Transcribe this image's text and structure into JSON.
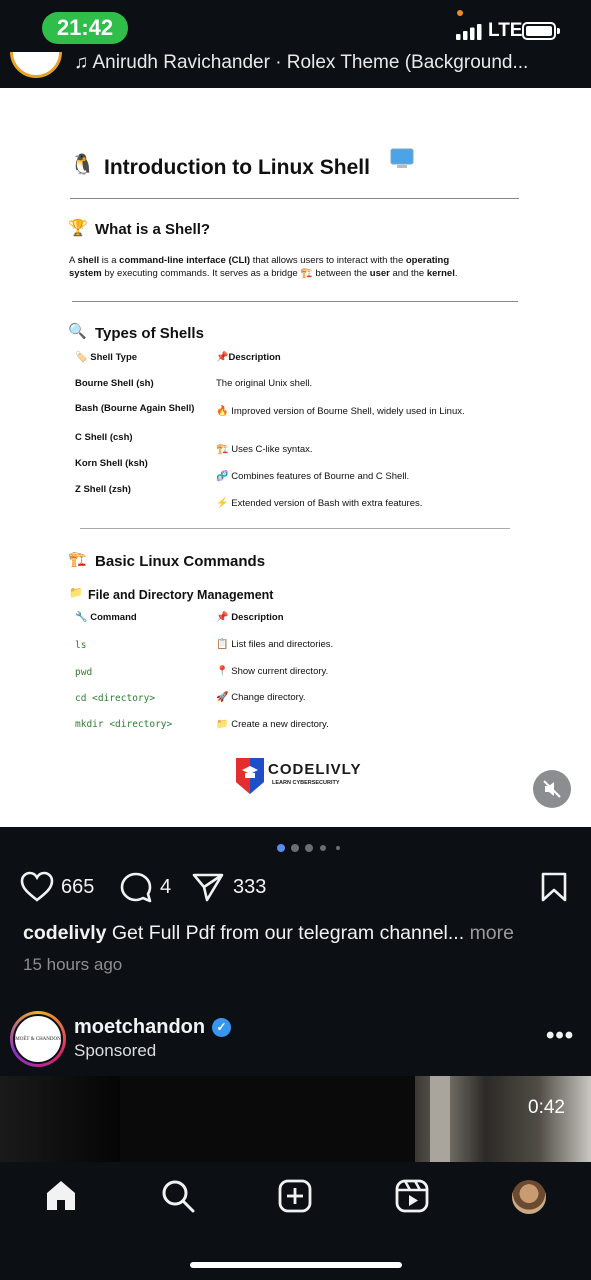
{
  "status_bar": {
    "time": "21:42",
    "network": "LTE"
  },
  "audio": {
    "text": "Anirudh Ravichander · Rolex Theme (Background..."
  },
  "post_image": {
    "title": "Introduction to Linux Shell",
    "what_heading": "What is a Shell?",
    "what_body": {
      "p1": "A ",
      "b1": "shell",
      "p2": " is a ",
      "b2": "command-line interface (CLI)",
      "p3": " that allows users to interact with the ",
      "b3": "operating",
      "b4": "system",
      "p4": " by executing commands. It serves as a bridge ",
      "p5": " between the ",
      "b5": "user",
      "p6": " and the ",
      "b6": "kernel",
      "p7": "."
    },
    "types_heading": "Types of Shells",
    "types_headers": [
      "Shell Type",
      "Description"
    ],
    "types_rows": [
      {
        "name": "Bourne Shell (sh)",
        "desc": "The original Unix shell."
      },
      {
        "name": "Bash (Bourne Again Shell)",
        "desc": "Improved version of Bourne Shell, widely used in Linux."
      },
      {
        "name": "C Shell (csh)",
        "desc": "Uses C-like syntax."
      },
      {
        "name": "Korn Shell (ksh)",
        "desc": "Combines features of Bourne and C Shell."
      },
      {
        "name": "Z Shell (zsh)",
        "desc": "Extended version of Bash with extra features."
      }
    ],
    "commands_heading": "Basic Linux Commands",
    "file_heading": "File and Directory Management",
    "cmd_headers": [
      "Command",
      "Description"
    ],
    "cmd_rows": [
      {
        "cmd": "ls",
        "desc": "List files and directories."
      },
      {
        "cmd": "pwd",
        "desc": "Show current directory."
      },
      {
        "cmd": "cd <directory>",
        "desc": "Change directory."
      },
      {
        "cmd": "mkdir <directory>",
        "desc": "Create a new directory."
      }
    ],
    "logo_title": "CODELIVLY",
    "logo_subtitle": "LEARN CYBERSECURITY"
  },
  "actions": {
    "likes": "665",
    "comments": "4",
    "shares": "333"
  },
  "caption": {
    "username": "codelivly",
    "text": "Get Full Pdf from our telegram channel...",
    "more": "more"
  },
  "posted_time": "15 hours ago",
  "sponsored_post": {
    "username": "moetchandon",
    "label": "Sponsored",
    "avatar_text": "MOËT & CHANDON",
    "video_time": "0:42"
  },
  "colors": {
    "accent_green": "#2fbe4a",
    "verified_blue": "#3797f0",
    "dot_active": "#5b8def"
  },
  "icons": [
    "heart-icon",
    "comment-icon",
    "share-icon",
    "bookmark-icon",
    "home-icon",
    "search-icon",
    "create-icon",
    "reels-icon",
    "mute-icon"
  ]
}
